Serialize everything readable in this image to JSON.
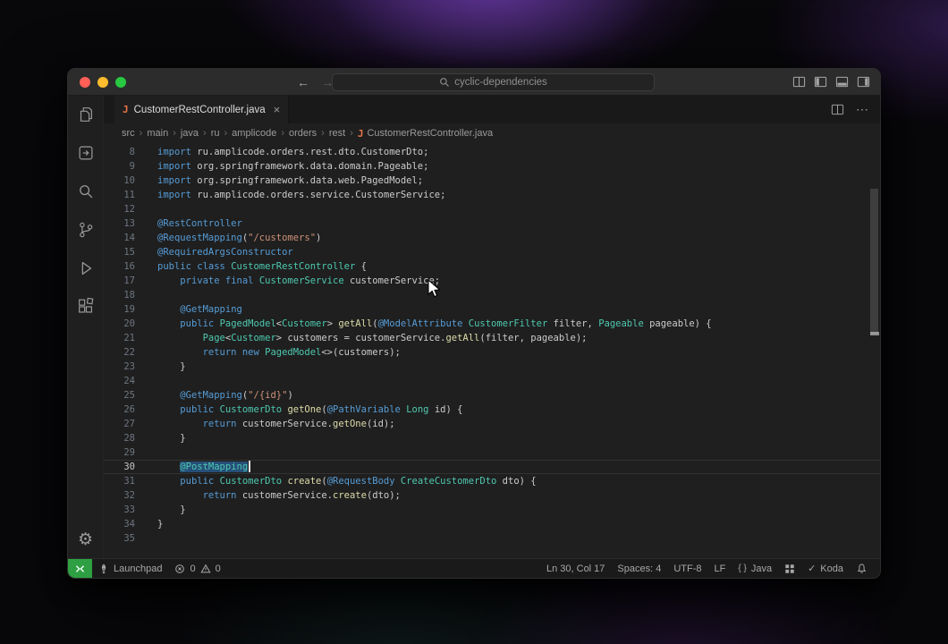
{
  "titlebar": {
    "search_text": "cyclic-dependencies"
  },
  "tab": {
    "label": "CustomerRestController.java"
  },
  "breadcrumbs": {
    "items": [
      "src",
      "main",
      "java",
      "ru",
      "amplicode",
      "orders",
      "rest",
      "CustomerRestController.java"
    ],
    "separator": "›"
  },
  "icons": {
    "java_badge": "J",
    "close": "×",
    "back": "←",
    "forward": "→",
    "gear": "⚙",
    "more": "⋯",
    "braces": "{ }",
    "check": "✓"
  },
  "editor": {
    "lines": [
      {
        "n": 8,
        "t": [
          [
            "kw",
            "import "
          ],
          [
            "pl",
            "ru.amplicode.orders.rest.dto.CustomerDto;"
          ]
        ]
      },
      {
        "n": 9,
        "t": [
          [
            "kw",
            "import "
          ],
          [
            "pl",
            "org.springframework.data.domain.Pageable;"
          ]
        ]
      },
      {
        "n": 10,
        "t": [
          [
            "kw",
            "import "
          ],
          [
            "pl",
            "org.springframework.data.web.PagedModel;"
          ]
        ]
      },
      {
        "n": 11,
        "t": [
          [
            "kw",
            "import "
          ],
          [
            "pl",
            "ru.amplicode.orders.service.CustomerService;"
          ]
        ]
      },
      {
        "n": 12,
        "t": []
      },
      {
        "n": 13,
        "t": [
          [
            "kw",
            "@RestController"
          ]
        ]
      },
      {
        "n": 14,
        "t": [
          [
            "kw",
            "@RequestMapping"
          ],
          [
            "pl",
            "("
          ],
          [
            "st",
            "\"/customers\""
          ],
          [
            "pl",
            ")"
          ]
        ]
      },
      {
        "n": 15,
        "t": [
          [
            "kw",
            "@RequiredArgsConstructor"
          ]
        ]
      },
      {
        "n": 16,
        "t": [
          [
            "kw",
            "public class "
          ],
          [
            "ty",
            "CustomerRestController"
          ],
          [
            "pl",
            " {"
          ]
        ]
      },
      {
        "n": 17,
        "t": [
          [
            "pl",
            "    "
          ],
          [
            "kw",
            "private final "
          ],
          [
            "ty",
            "CustomerService"
          ],
          [
            "pl",
            " customerService;"
          ]
        ]
      },
      {
        "n": 18,
        "t": []
      },
      {
        "n": 19,
        "t": [
          [
            "pl",
            "    "
          ],
          [
            "kw",
            "@GetMapping"
          ]
        ]
      },
      {
        "n": 20,
        "t": [
          [
            "pl",
            "    "
          ],
          [
            "kw",
            "public "
          ],
          [
            "ty",
            "PagedModel"
          ],
          [
            "pl",
            "<"
          ],
          [
            "ty",
            "Customer"
          ],
          [
            "pl",
            "> "
          ],
          [
            "fn",
            "getAll"
          ],
          [
            "pl",
            "("
          ],
          [
            "kw",
            "@ModelAttribute "
          ],
          [
            "ty",
            "CustomerFilter"
          ],
          [
            "pl",
            " filter, "
          ],
          [
            "ty",
            "Pageable"
          ],
          [
            "pl",
            " pageable) {"
          ]
        ]
      },
      {
        "n": 21,
        "t": [
          [
            "pl",
            "        "
          ],
          [
            "ty",
            "Page"
          ],
          [
            "pl",
            "<"
          ],
          [
            "ty",
            "Customer"
          ],
          [
            "pl",
            "> customers = customerService."
          ],
          [
            "fn",
            "getAll"
          ],
          [
            "pl",
            "(filter, pageable);"
          ]
        ]
      },
      {
        "n": 22,
        "t": [
          [
            "pl",
            "        "
          ],
          [
            "kw",
            "return new "
          ],
          [
            "ty",
            "PagedModel"
          ],
          [
            "pl",
            "<>(customers);"
          ]
        ]
      },
      {
        "n": 23,
        "t": [
          [
            "pl",
            "    }"
          ]
        ]
      },
      {
        "n": 24,
        "t": []
      },
      {
        "n": 25,
        "t": [
          [
            "pl",
            "    "
          ],
          [
            "kw",
            "@GetMapping"
          ],
          [
            "pl",
            "("
          ],
          [
            "st",
            "\"/{id}\""
          ],
          [
            "pl",
            ")"
          ]
        ]
      },
      {
        "n": 26,
        "t": [
          [
            "pl",
            "    "
          ],
          [
            "kw",
            "public "
          ],
          [
            "ty",
            "CustomerDto"
          ],
          [
            "pl",
            " "
          ],
          [
            "fn",
            "getOne"
          ],
          [
            "pl",
            "("
          ],
          [
            "kw",
            "@PathVariable "
          ],
          [
            "ty",
            "Long"
          ],
          [
            "pl",
            " id) {"
          ]
        ]
      },
      {
        "n": 27,
        "t": [
          [
            "pl",
            "        "
          ],
          [
            "kw",
            "return "
          ],
          [
            "pl",
            "customerService."
          ],
          [
            "fn",
            "getOne"
          ],
          [
            "pl",
            "(id);"
          ]
        ]
      },
      {
        "n": 28,
        "t": [
          [
            "pl",
            "    }"
          ]
        ]
      },
      {
        "n": 29,
        "t": []
      },
      {
        "n": 30,
        "t": [
          [
            "pl",
            "    "
          ],
          [
            "sel",
            "@PostMapping"
          ]
        ],
        "current": true,
        "caret": true
      },
      {
        "n": 31,
        "t": [
          [
            "pl",
            "    "
          ],
          [
            "kw",
            "public "
          ],
          [
            "ty",
            "CustomerDto"
          ],
          [
            "pl",
            " "
          ],
          [
            "fn",
            "create"
          ],
          [
            "pl",
            "("
          ],
          [
            "kw",
            "@RequestBody "
          ],
          [
            "ty",
            "CreateCustomerDto"
          ],
          [
            "pl",
            " dto) {"
          ]
        ]
      },
      {
        "n": 32,
        "t": [
          [
            "pl",
            "        "
          ],
          [
            "kw",
            "return "
          ],
          [
            "pl",
            "customerService."
          ],
          [
            "fn",
            "create"
          ],
          [
            "pl",
            "(dto);"
          ]
        ]
      },
      {
        "n": 33,
        "t": [
          [
            "pl",
            "    }"
          ]
        ]
      },
      {
        "n": 34,
        "t": [
          [
            "pl",
            "}"
          ]
        ]
      },
      {
        "n": 35,
        "t": []
      }
    ]
  },
  "statusbar": {
    "launchpad": "Launchpad",
    "errors": "0",
    "warnings": "0",
    "line_col": "Ln 30, Col 17",
    "spaces": "Spaces: 4",
    "encoding": "UTF-8",
    "eol": "LF",
    "language": "Java",
    "koda": "Koda"
  },
  "colors": {
    "selection_bg": "#264f78",
    "keyword": "#569cd6",
    "type": "#4ec9b0",
    "string": "#ce9178",
    "java_badge": "#e8744a",
    "remote_green": "#2ea043"
  }
}
